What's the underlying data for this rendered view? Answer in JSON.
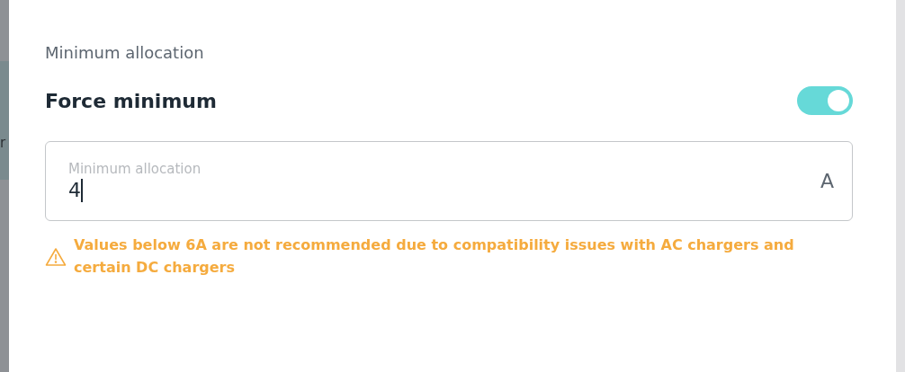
{
  "backdrop": {
    "text": "r"
  },
  "section": {
    "title": "Minimum allocation"
  },
  "force_minimum": {
    "label": "Force minimum",
    "on": true
  },
  "field": {
    "label": "Minimum allocation",
    "value": "4",
    "unit": "A",
    "focused": true
  },
  "warning": {
    "text": "Values below 6A are not recommended due to compatibility issues with AC chargers and certain DC chargers"
  }
}
